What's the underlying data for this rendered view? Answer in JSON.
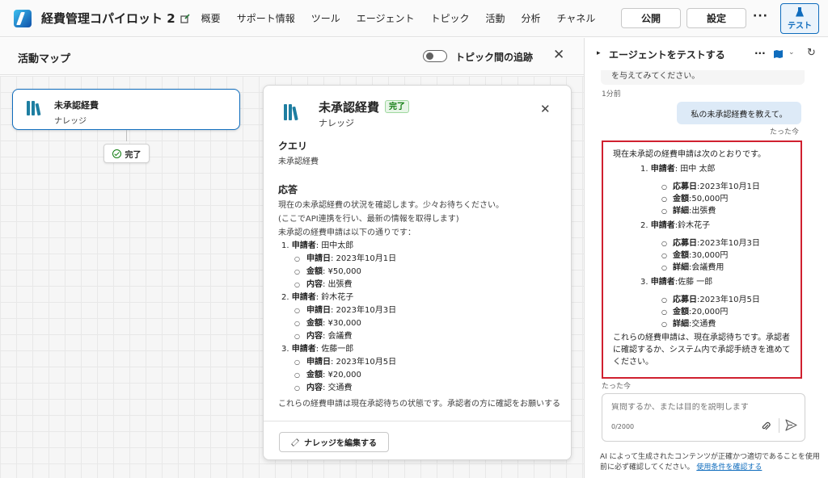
{
  "app": {
    "title": "経費管理コパイロット 2"
  },
  "nav": [
    "概要",
    "サポート情報",
    "ツール",
    "エージェント",
    "トピック",
    "活動",
    "分析",
    "チャネル"
  ],
  "actions": {
    "publish": "公開",
    "settings": "設定",
    "more": "···",
    "test": "テスト"
  },
  "activity_map": {
    "title": "活動マップ",
    "toggle_label": "トピック間の追跡",
    "close": "✕",
    "node": {
      "title": "未承認経費",
      "subtitle": "ナレッジ"
    },
    "status": "完了"
  },
  "detail": {
    "title": "未承認経費",
    "badge": "完了",
    "subtitle": "ナレッジ",
    "close": "✕",
    "query_heading": "クエリ",
    "query_text": "未承認経費",
    "answer_heading": "応答",
    "answer_lines": [
      "現在の未承認経費の状況を確認します。少々お待ちください。",
      "(ここでAPI連携を行い、最新の情報を取得します)",
      "未承認の経費申請は以下の通りです："
    ],
    "items": [
      {
        "num": "1.",
        "label": "申請者",
        "value": ": 田中太郎",
        "details": [
          {
            "label": "申請日",
            "value": ": 2023年10月1日"
          },
          {
            "label": "金額",
            "value": ": ¥50,000"
          },
          {
            "label": "内容",
            "value": ": 出張費"
          }
        ]
      },
      {
        "num": "2.",
        "label": "申請者",
        "value": ": 鈴木花子",
        "details": [
          {
            "label": "申請日",
            "value": ": 2023年10月3日"
          },
          {
            "label": "金額",
            "value": ": ¥30,000"
          },
          {
            "label": "内容",
            "value": ": 会議費"
          }
        ]
      },
      {
        "num": "3.",
        "label": "申請者",
        "value": ": 佐藤一郎",
        "details": [
          {
            "label": "申請日",
            "value": ": 2023年10月5日"
          },
          {
            "label": "金額",
            "value": ": ¥20,000"
          },
          {
            "label": "内容",
            "value": ": 交通費"
          }
        ]
      }
    ],
    "closing": "これらの経費申請は現在承認待ちの状態です。承認者の方に確認をお願いするか、システム上で承認プロセスを進めてください。",
    "edit_button": "ナレッジを編集する"
  },
  "test_pane": {
    "title": "エージェントをテストする",
    "prev_message": "を与えてみてください。",
    "prev_time": "1分前",
    "user_message": "私の未承認経費を教えて。",
    "user_time": "たった今",
    "bot": {
      "intro": "現在未承認の経費申請は次のとおりです。",
      "items": [
        {
          "num": "1.",
          "label": "申請者",
          "value": ": 田中 太郎",
          "details": [
            {
              "label": "応募日",
              "value": ":2023年10月1日"
            },
            {
              "label": "金額",
              "value": ":50,000円"
            },
            {
              "label": "詳細",
              "value": ":出張費"
            }
          ]
        },
        {
          "num": "2.",
          "label": "申請者",
          "value": ":鈴木花子",
          "details": [
            {
              "label": "応募日",
              "value": ":2023年10月3日"
            },
            {
              "label": "金額",
              "value": ":30,000円"
            },
            {
              "label": "詳細",
              "value": ":会議費用"
            }
          ]
        },
        {
          "num": "3.",
          "label": "申請者",
          "value": ":佐藤 一郎",
          "details": [
            {
              "label": "応募日",
              "value": ":2023年10月5日"
            },
            {
              "label": "金額",
              "value": ":20,000円"
            },
            {
              "label": "詳細",
              "value": ":交通費"
            }
          ]
        }
      ],
      "closing": "これらの経費申請は、現在承認待ちです。承認者に確認するか、システム内で承認手続きを進めてください。",
      "time": "たった今"
    },
    "input_placeholder": "質問するか、または目的を説明します",
    "char_count": "0/2000",
    "disclaimer": "AI によって生成されたコンテンツが正確かつ適切であることを使用前に必ず確認してください。",
    "terms_link": "使用条件を確認する"
  },
  "colors": {
    "accent": "#0f6cbd",
    "highlight_border": "#d0202f",
    "success": "#107c10"
  }
}
